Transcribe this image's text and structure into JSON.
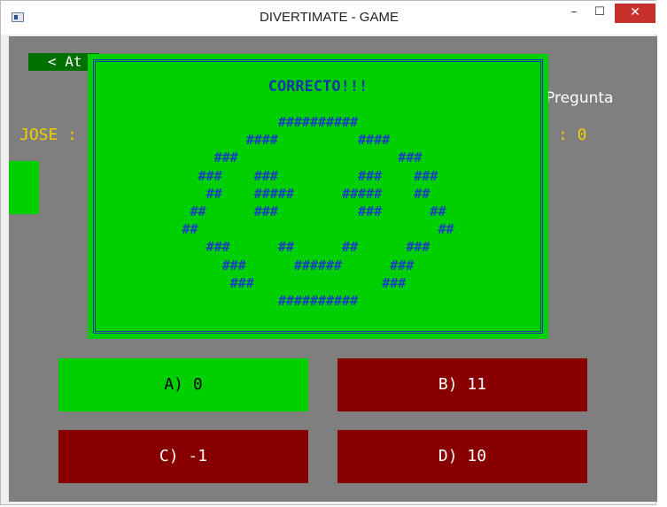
{
  "window": {
    "title": "DIVERTIMATE - GAME",
    "minimize": "–",
    "maximize": "☐",
    "close": "✕"
  },
  "game": {
    "back_button": "< At",
    "player": "JOSE :",
    "question_label": "Pregunta",
    "score": ": 0"
  },
  "modal": {
    "title": "CORRECTO!!!",
    "art": "##########\n####          ####\n###                    ###\n###    ###          ###    ###\n##    #####      #####    ##\n##      ###          ###      ##\n##                              ##\n###      ##      ##      ###\n###      ######      ###\n###                ###\n##########"
  },
  "answers": {
    "a": "A) 0",
    "b": "B) 11",
    "c": "C) -1",
    "d": "D) 10"
  },
  "colors": {
    "canvas": "#7f7f7f",
    "correct_green": "#00d000",
    "wrong_red": "#880000",
    "text_yellow": "#f1d000",
    "modal_blue": "#1536a8",
    "close_red": "#c7312b"
  }
}
